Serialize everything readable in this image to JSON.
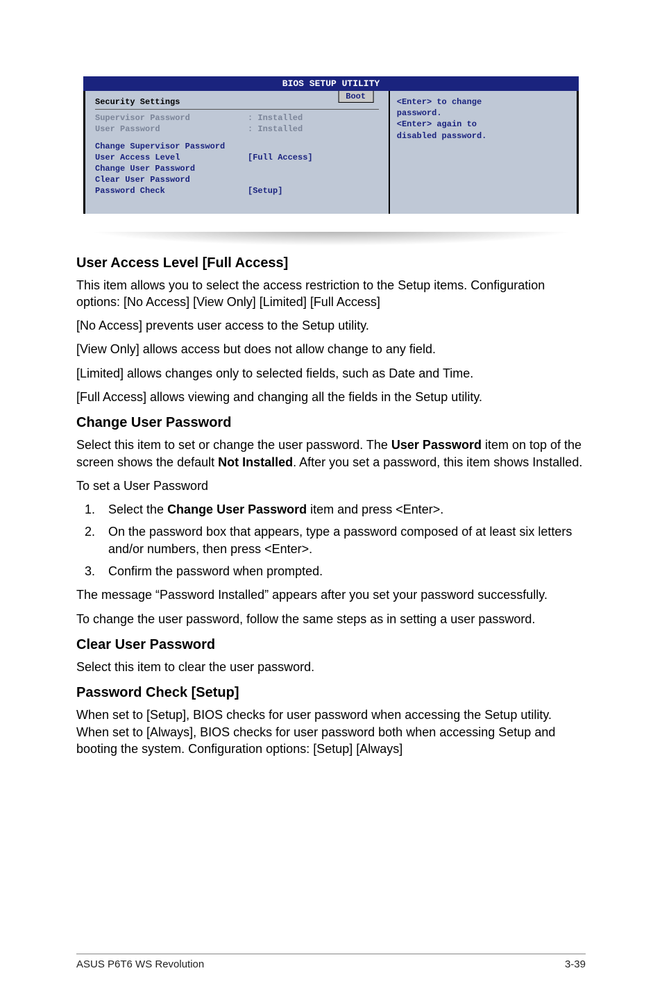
{
  "bios": {
    "title": "BIOS SETUP UTILITY",
    "tab": "Boot",
    "section": "Security Settings",
    "rows": {
      "sup_label": "Supervisor Password",
      "sup_val": ": Installed",
      "user_label": "User Password",
      "user_val": ": Installed",
      "csp": "Change Supervisor Password",
      "ual_label": "User Access Level",
      "ual_val": "[Full Access]",
      "cup": "Change User Password",
      "clr": "Clear User Password",
      "pc_label": "Password Check",
      "pc_val": "[Setup]"
    },
    "help": {
      "l1": "<Enter> to change",
      "l2": "password.",
      "l3": "<Enter> again to",
      "l4": "disabled password."
    }
  },
  "doc": {
    "h_ual": "User Access Level [Full Access]",
    "p_ual1": "This item allows you to select the access restriction to the Setup items. Configuration options: [No Access] [View Only] [Limited] [Full Access]",
    "p_ual_na": "[No Access] prevents user access to the Setup utility.",
    "p_ual_vo": "[View Only] allows access but does not allow change to any field.",
    "p_ual_lim": "[Limited] allows changes only to selected fields, such as Date and Time.",
    "p_ual_fa": "[Full Access] allows viewing and changing all the fields in the Setup utility.",
    "h_cup": "Change User Password",
    "p_cup1a": "Select this item to set or change the user password. The ",
    "p_cup1b": "User Password",
    "p_cup1c": " item on top of the screen shows the default ",
    "p_cup1d": "Not Installed",
    "p_cup1e": ". After you set a password, this item shows Installed.",
    "p_cup2": "To set a User Password",
    "li1a": "Select the ",
    "li1b": "Change User Password",
    "li1c": " item and press <Enter>.",
    "li2": "On the password box that appears, type a password composed of at least six letters and/or numbers, then press <Enter>.",
    "li3": "Confirm the password when prompted.",
    "p_cup3": "The message “Password Installed” appears after you set your password successfully.",
    "p_cup4": "To change the user password, follow the same steps as in setting a user password.",
    "h_clr": "Clear User Password",
    "p_clr": "Select this item to clear the user password.",
    "h_pc": "Password Check [Setup]",
    "p_pc": "When set to [Setup], BIOS checks for user password when accessing the Setup utility. When set to [Always], BIOS checks for user password both when accessing Setup and booting the system. Configuration options: [Setup] [Always]"
  },
  "footer": {
    "left": "ASUS P6T6 WS Revolution",
    "right": "3-39"
  }
}
